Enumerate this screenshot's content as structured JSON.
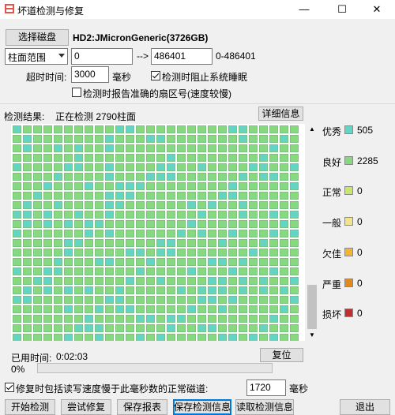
{
  "window": {
    "title": "坏道检测与修复"
  },
  "top": {
    "select_disk_label": "选择磁盘",
    "disk_name": "HD2:JMicronGeneric(3726GB)",
    "range_mode": "柱面范围",
    "range_start": "0",
    "arrow": "-->",
    "range_end": "486401",
    "range_info": "0-486401",
    "timeout_label": "超时时间:",
    "timeout_value": "3000",
    "timeout_unit": "毫秒",
    "prevent_sleep_label": "检测时阻止系统睡眠",
    "prevent_sleep_checked": true,
    "report_exact_label": "检测时报告准确的扇区号(速度较慢)",
    "report_exact_checked": false
  },
  "results": {
    "label": "检测结果:",
    "status": "正在检测 2790柱面",
    "details_button": "详细信息"
  },
  "legend": [
    {
      "label": "优秀",
      "count": "505",
      "color": "#63d6c3"
    },
    {
      "label": "良好",
      "count": "2285",
      "color": "#86d97f"
    },
    {
      "label": "正常",
      "count": "0",
      "color": "#c8e86a"
    },
    {
      "label": "一般",
      "count": "0",
      "color": "#f4e38d"
    },
    {
      "label": "欠佳",
      "count": "0",
      "color": "#f2b630"
    },
    {
      "label": "严重",
      "count": "0",
      "color": "#e08a1e"
    },
    {
      "label": "损坏",
      "count": "0",
      "color": "#c03030"
    }
  ],
  "grid": {
    "columns": 28,
    "rows": 23
  },
  "bottom": {
    "elapsed_label": "已用时间:",
    "elapsed_value": "0:02:03",
    "reset_button": "复位",
    "progress_label": "0%",
    "progress": 0,
    "repair_label": "修复时包括读写速度慢于此毫秒数的正常磁道:",
    "repair_checked": true,
    "repair_ms": "1720",
    "repair_unit": "毫秒"
  },
  "buttons": {
    "start": "开始检测",
    "try_repair": "尝试修复",
    "save_report": "保存报表",
    "save_info": "保存检测信息",
    "load_info": "读取检测信息",
    "exit": "退出"
  }
}
